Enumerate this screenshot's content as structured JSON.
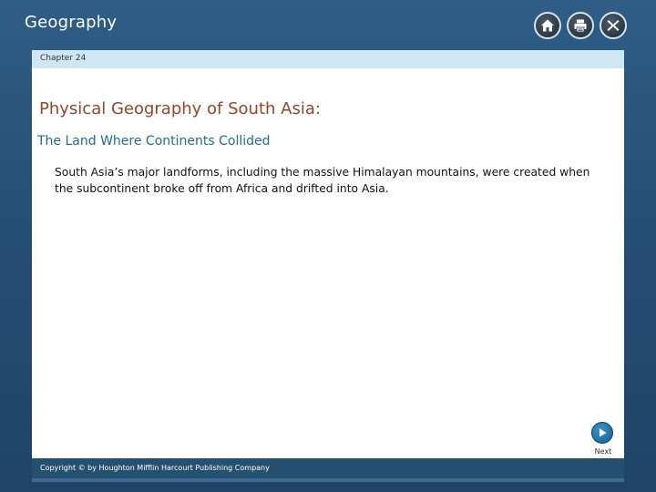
{
  "app": {
    "title": "Geography"
  },
  "toolbar": {
    "buttons": [
      {
        "icon": "home-icon"
      },
      {
        "icon": "print-icon"
      },
      {
        "icon": "close-icon"
      }
    ]
  },
  "chapter": {
    "label": "Chapter 24"
  },
  "content": {
    "title": "Physical Geography of South Asia:",
    "subtitle": "The Land Where Continents Collided",
    "body": "South Asia’s major landforms, including the massive Himalayan mountains, were created when the subcontinent broke off from Africa and drifted into Asia."
  },
  "navigation": {
    "next_label": "Next"
  },
  "footer": {
    "copyright": "Copyright © by Houghton Mifflin Harcourt Publishing Company"
  },
  "colors": {
    "frame": "#2f5d86",
    "chapter_bar": "#cfe7f3",
    "title": "#9a4424",
    "subtitle": "#1e6e91"
  }
}
